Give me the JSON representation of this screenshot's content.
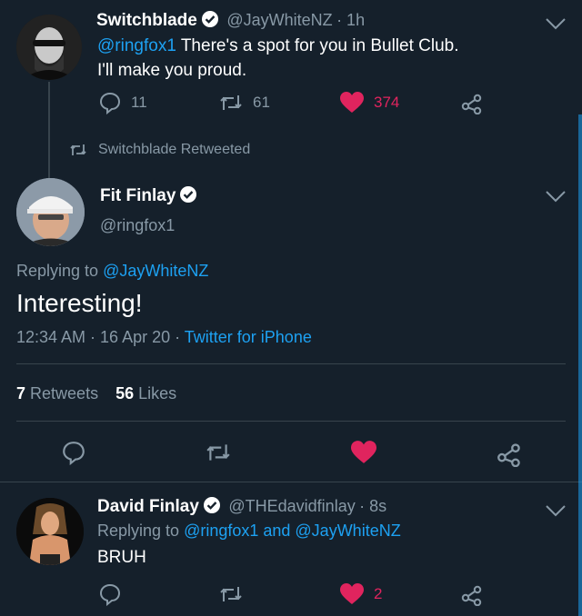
{
  "colors": {
    "background": "#15202b",
    "muted": "#8899a6",
    "link": "#1da1f2",
    "like": "#e0245e",
    "divider": "#38444d"
  },
  "tweet1": {
    "display_name": "Switchblade",
    "handle": "@JayWhiteNZ",
    "time": "· 1h",
    "mention": "@ringfox1",
    "text_line1": " There's a spot for you in Bullet Club.",
    "text_line2": "I'll make you proud.",
    "replies": "11",
    "retweets": "61",
    "likes": "374"
  },
  "retweet_notice": "Switchblade Retweeted",
  "main": {
    "display_name": "Fit Finlay",
    "handle": "@ringfox1",
    "replying_prefix": "Replying to ",
    "replying_handle": "@JayWhiteNZ",
    "text": "Interesting!",
    "datetime": "12:34 AM · 16 Apr 20 · ",
    "source": "Twitter for iPhone",
    "retweet_count": "7",
    "retweet_label": "Retweets",
    "like_count": "56",
    "like_label": "Likes"
  },
  "reply": {
    "display_name": "David Finlay",
    "handle": "@THEdavidfinlay",
    "time": "· 8s",
    "replying_prefix": "Replying to ",
    "replying_handles": "@ringfox1 and @JayWhiteNZ",
    "text": "BRUH",
    "likes": "2"
  },
  "icons": [
    "verified-badge-icon",
    "chevron-down-icon",
    "reply-icon",
    "retweet-icon",
    "heart-icon",
    "share-icon"
  ]
}
